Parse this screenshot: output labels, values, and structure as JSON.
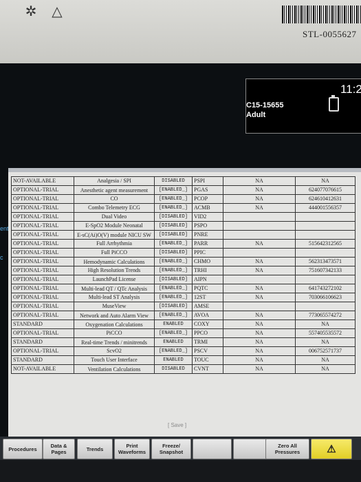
{
  "bezel": {
    "icons": [
      "sun-star-icon",
      "warning-triangle-icon"
    ],
    "asset_tag": "STL-0055627"
  },
  "header": {
    "patient_id": "C15-15655",
    "patient_type": "Adult",
    "time": "11:2"
  },
  "sidebar": {
    "labels": [
      "ent",
      "c"
    ]
  },
  "options_table": {
    "rows": [
      [
        "NOT-AVAILABLE",
        "Analgesia / SPI",
        "DISABLED",
        "PSPI",
        "NA",
        "NA"
      ],
      [
        "OPTIONAL-TRIAL",
        "Anesthetic agent measurement",
        "[ENABLED_]",
        "PGAS",
        "NA",
        "624077076615"
      ],
      [
        "OPTIONAL-TRIAL",
        "CO",
        "[ENABLED_]",
        "PCOP",
        "NA",
        "624610412631"
      ],
      [
        "OPTIONAL-TRIAL",
        "Combo Telemetry ECG",
        "[ENABLED_]",
        "ACMB",
        "NA",
        "444001556357"
      ],
      [
        "OPTIONAL-TRIAL",
        "Dual Video",
        "[DISABLED]",
        "VID2",
        "",
        ""
      ],
      [
        "OPTIONAL-TRIAL",
        "E-SpO2 Module Neonatal",
        "[DISABLED]",
        "PSPO",
        "",
        ""
      ],
      [
        "OPTIONAL-TRIAL",
        "E-sC(Ai)O(V) module NICU SW",
        "[DISABLED]",
        "PNRE",
        "",
        ""
      ],
      [
        "OPTIONAL-TRIAL",
        "Full Arrhythmia",
        "[ENABLED_]",
        "PARR",
        "NA",
        "515642312565"
      ],
      [
        "OPTIONAL-TRIAL",
        "Full PiCCO",
        "[DISABLED]",
        "PPIC",
        "",
        ""
      ],
      [
        "OPTIONAL-TRIAL",
        "Hemodynamic Calculations",
        "[ENABLED_]",
        "CHMO",
        "NA",
        "562313473571"
      ],
      [
        "OPTIONAL-TRIAL",
        "High Resolution Trends",
        "[ENABLED_]",
        "TRHI",
        "NA",
        "751607342133"
      ],
      [
        "OPTIONAL-TRIAL",
        "LaunchPad License",
        "[DISABLED]",
        "AIPN",
        "",
        ""
      ],
      [
        "OPTIONAL-TRIAL",
        "Multi-lead QT / QTc Analysis",
        "[ENABLED_]",
        "PQTC",
        "NA",
        "641743272102"
      ],
      [
        "OPTIONAL-TRIAL",
        "Multi-lead ST Analysis",
        "[ENABLED_]",
        "12ST",
        "NA",
        "703066106623"
      ],
      [
        "OPTIONAL-TRIAL",
        "MuseView",
        "[DISABLED]",
        "AMSE",
        "",
        ""
      ],
      [
        "OPTIONAL-TRIAL",
        "Network and Auto Alarm View",
        "[ENABLED_]",
        "AVOA",
        "NA",
        "773065574272"
      ],
      [
        "STANDARD",
        "Oxygenation Calculations",
        "ENABLED",
        "COXY",
        "NA",
        "NA"
      ],
      [
        "OPTIONAL-TRIAL",
        "PiCCO",
        "[ENABLED_]",
        "PPCO",
        "NA",
        "557405535572"
      ],
      [
        "STANDARD",
        "Real-time Trends / minitrends",
        "ENABLED",
        "TRMI",
        "NA",
        "NA"
      ],
      [
        "OPTIONAL-TRIAL",
        "ScvO2",
        "[ENABLED_]",
        "PSCV",
        "NA",
        "006752571737"
      ],
      [
        "STANDARD",
        "Touch User Interface",
        "ENABLED",
        "TOUC",
        "NA",
        "NA"
      ],
      [
        "NOT-AVAILABLE",
        "Ventilation Calculations",
        "DISABLED",
        "CVNT",
        "NA",
        "NA"
      ]
    ]
  },
  "dialog": {
    "save_label": "[ Save ]"
  },
  "softkeys": [
    {
      "label": "Procedures",
      "enabled": true
    },
    {
      "label": "Data & Pages",
      "enabled": true
    },
    {
      "label": "Trends",
      "enabled": true
    },
    {
      "label": "Print Waveforms",
      "enabled": true
    },
    {
      "label": "Freeze/ Snapshot",
      "enabled": true
    },
    {
      "label": "",
      "enabled": false
    },
    {
      "label": "",
      "enabled": false
    },
    {
      "label": "Zero All Pressures",
      "enabled": true
    }
  ],
  "colors": {
    "softkey_bg": "#dcdcdc",
    "alarm_yellow": "#efdf45",
    "sidebar_blue": "#56a6e0"
  }
}
